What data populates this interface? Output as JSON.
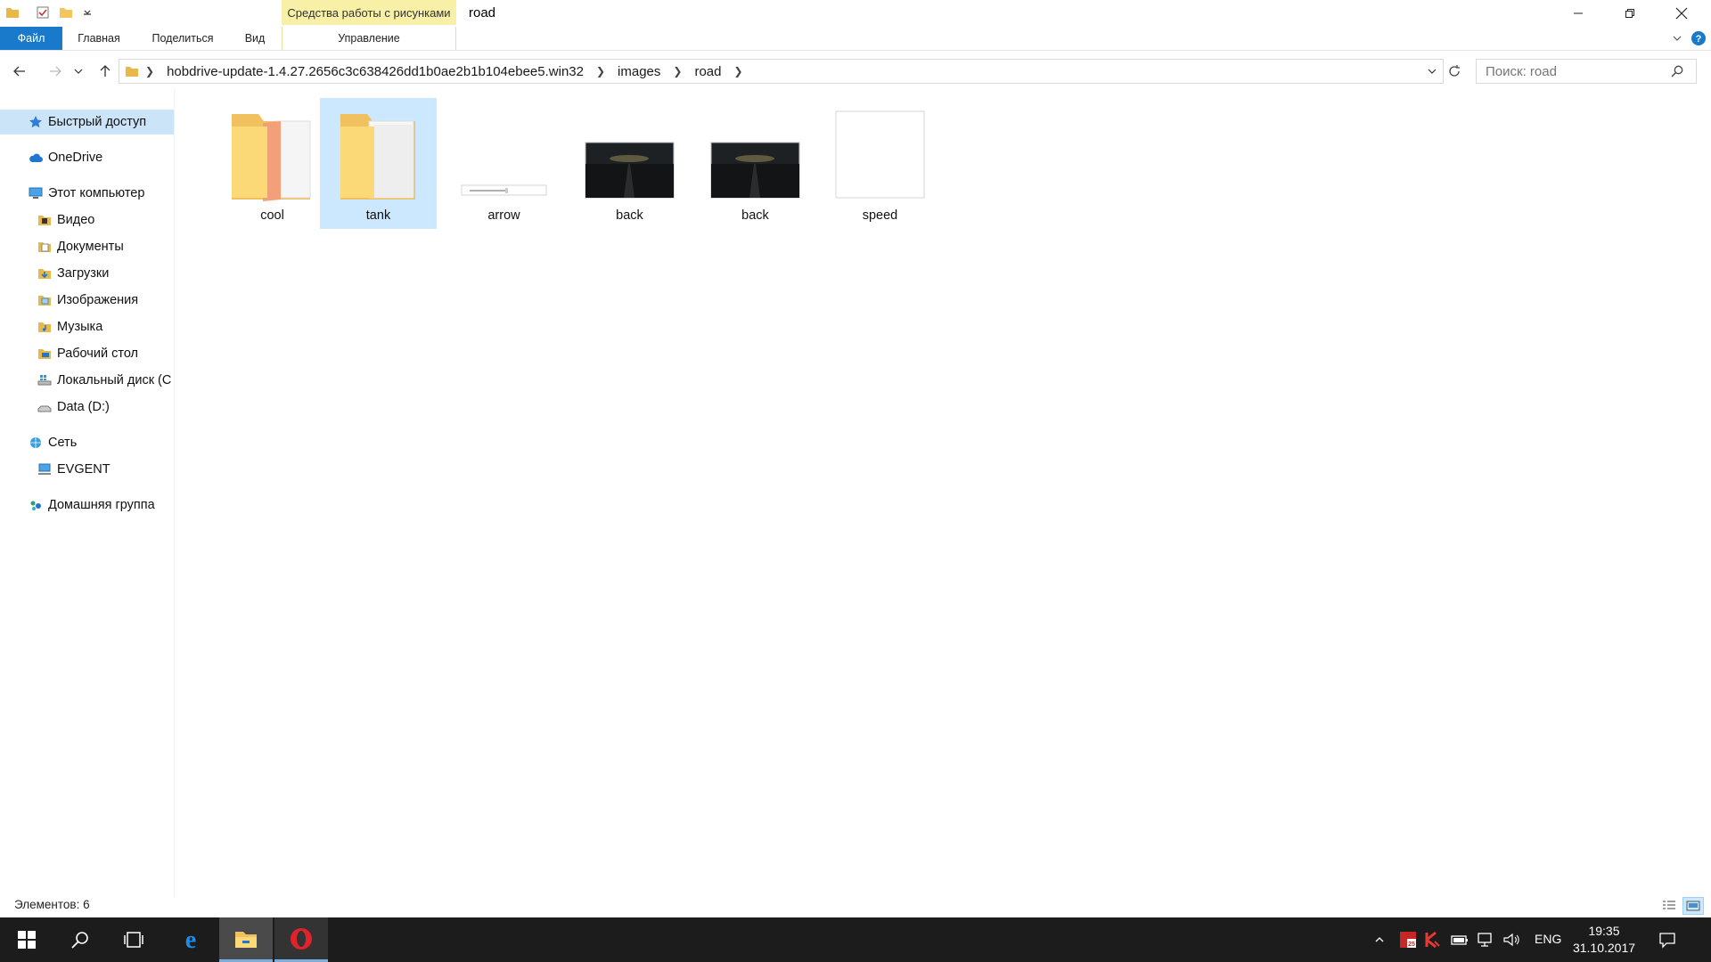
{
  "titlebar": {
    "context_tab_label": "Средства работы с рисунками",
    "title": "road"
  },
  "ribbon": {
    "tabs": [
      {
        "label": "Файл"
      },
      {
        "label": "Главная"
      },
      {
        "label": "Поделиться"
      },
      {
        "label": "Вид"
      },
      {
        "label": "Управление"
      }
    ]
  },
  "address": {
    "crumbs": [
      {
        "label": "hobdrive-update-1.4.27.2656c3c638426dd1b0ae2b1b104ebee5.win32"
      },
      {
        "label": "images"
      },
      {
        "label": "road"
      }
    ]
  },
  "search": {
    "placeholder": "Поиск: road"
  },
  "sidebar": {
    "items": [
      {
        "label": "Быстрый доступ",
        "icon": "star-icon"
      },
      {
        "label": "OneDrive",
        "icon": "cloud-icon"
      },
      {
        "label": "Этот компьютер",
        "icon": "computer-icon"
      },
      {
        "label": "Видео",
        "icon": "video-folder-icon"
      },
      {
        "label": "Документы",
        "icon": "documents-folder-icon"
      },
      {
        "label": "Загрузки",
        "icon": "downloads-folder-icon"
      },
      {
        "label": "Изображения",
        "icon": "pictures-folder-icon"
      },
      {
        "label": "Музыка",
        "icon": "music-folder-icon"
      },
      {
        "label": "Рабочий стол",
        "icon": "desktop-folder-icon"
      },
      {
        "label": "Локальный диск (C",
        "icon": "windows-drive-icon"
      },
      {
        "label": "Data (D:)",
        "icon": "drive-icon"
      },
      {
        "label": "Сеть",
        "icon": "network-icon"
      },
      {
        "label": "EVGENT",
        "icon": "network-computer-icon"
      },
      {
        "label": "Домашняя группа",
        "icon": "homegroup-icon"
      }
    ]
  },
  "files": [
    {
      "name": "cool",
      "kind": "folder"
    },
    {
      "name": "tank",
      "kind": "folder"
    },
    {
      "name": "arrow",
      "kind": "image"
    },
    {
      "name": "back",
      "kind": "image"
    },
    {
      "name": "back",
      "kind": "image"
    },
    {
      "name": "speed",
      "kind": "image"
    }
  ],
  "status": {
    "item_count": "Элементов: 6"
  },
  "taskbar": {
    "language": "ENG",
    "time": "19:35",
    "date": "31.10.2017"
  },
  "colors": {
    "accent": "#1979ca",
    "selection": "#cce8ff",
    "context_tab": "#f8f0a6",
    "taskbar": "#1c1c1c",
    "folder": "#fcd977"
  }
}
